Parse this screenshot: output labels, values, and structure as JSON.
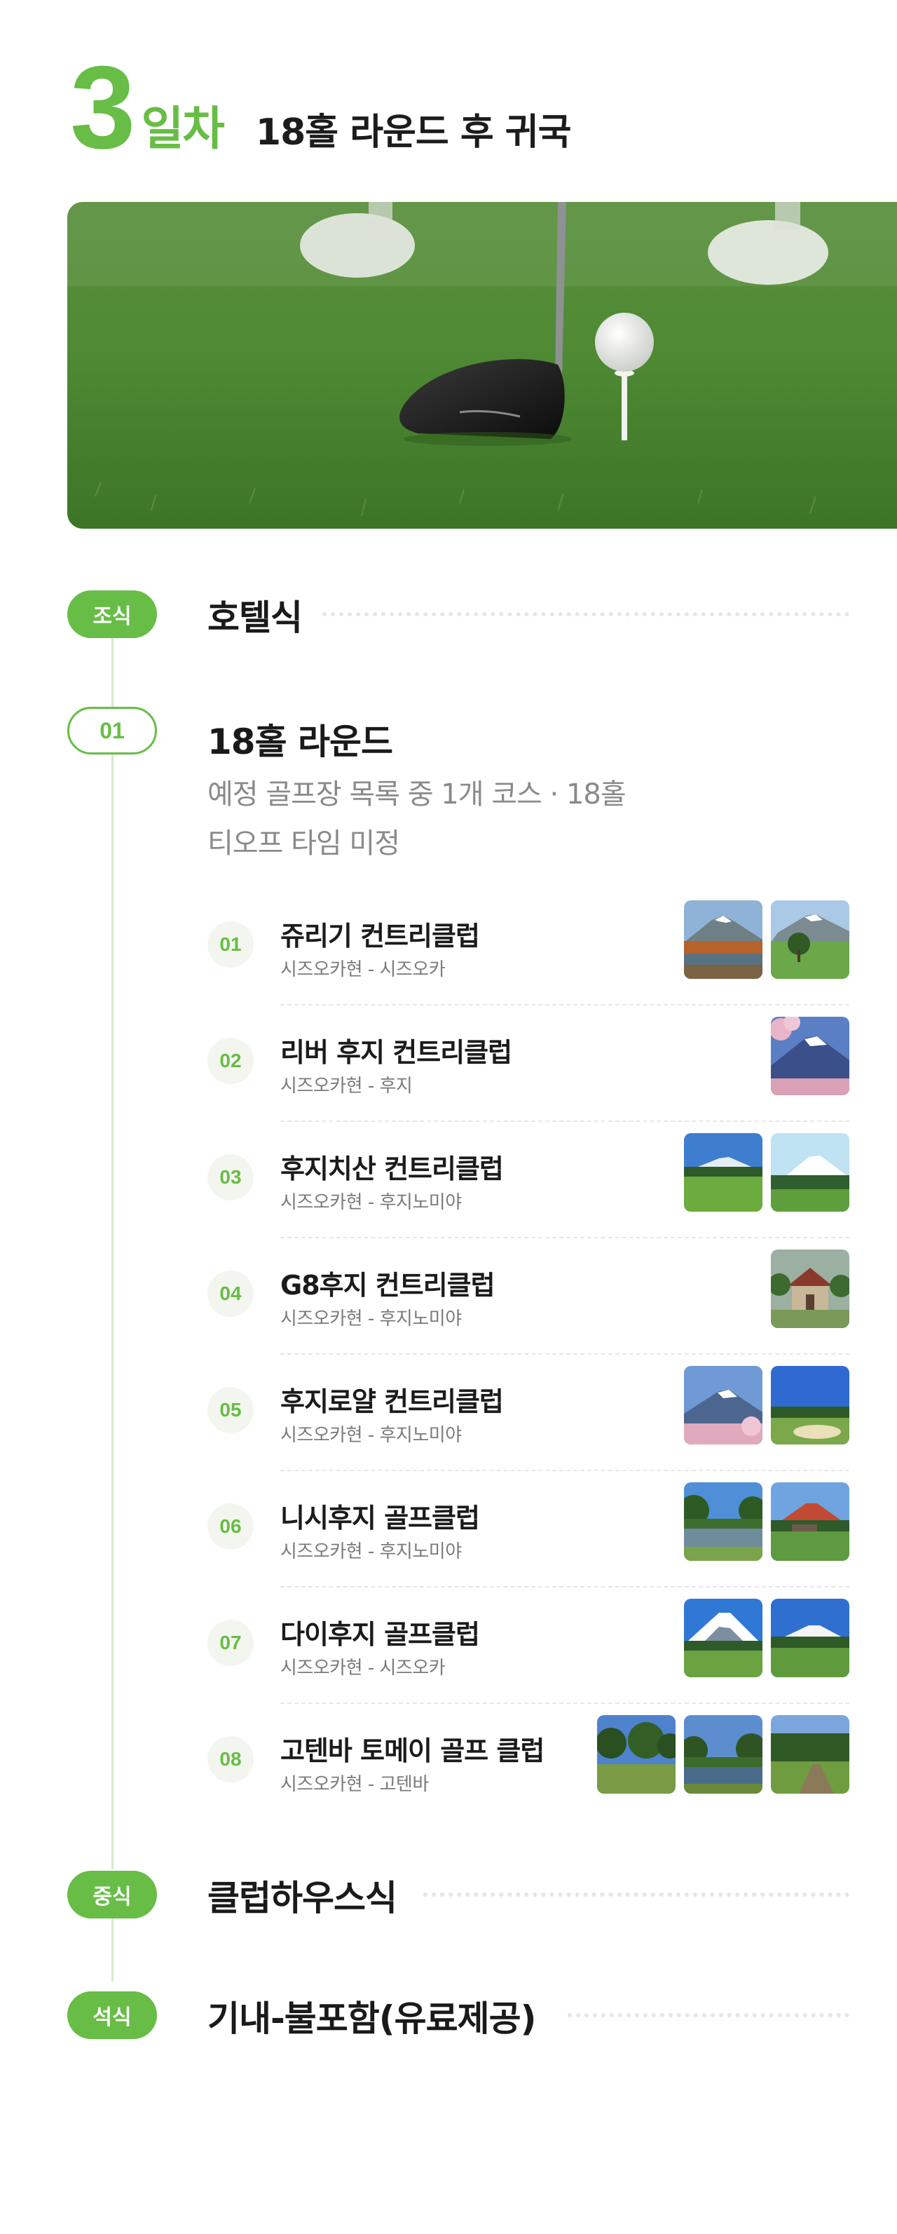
{
  "day": {
    "number": "3",
    "unit": "일차",
    "title": "18홀 라운드 후 귀국"
  },
  "hero": {
    "image": "golf-driver-tee-photo"
  },
  "breakfast": {
    "label": "조식",
    "value": "호텔식"
  },
  "round": {
    "label": "01",
    "title": "18홀 라운드",
    "sub1": "예정 골프장 목록 중 1개 코스 · 18홀",
    "sub2": "티오프 타임 미정"
  },
  "courses": [
    {
      "num": "01",
      "name": "쥬리기 컨트리클럽",
      "loc": "시즈오카현 - 시즈오카",
      "images": [
        "fuji-lake-autumn",
        "fuji-green-tree"
      ]
    },
    {
      "num": "02",
      "name": "리버 후지 컨트리클럽",
      "loc": "시즈오카현 - 후지",
      "images": [
        "fuji-cherry-blossom"
      ]
    },
    {
      "num": "03",
      "name": "후지치산 컨트리클럽",
      "loc": "시즈오카현 - 후지노미야",
      "images": [
        "fuji-fairway",
        "fuji-snow-cap"
      ]
    },
    {
      "num": "04",
      "name": "G8후지 컨트리클럽",
      "loc": "시즈오카현 - 후지노미야",
      "images": [
        "clubhouse-building"
      ]
    },
    {
      "num": "05",
      "name": "후지로얄 컨트리클럽",
      "loc": "시즈오카현 - 후지노미야",
      "images": [
        "fuji-cherry-blossom",
        "bunker-fairway"
      ]
    },
    {
      "num": "06",
      "name": "니시후지 골프클럽",
      "loc": "시즈오카현 - 후지노미야",
      "images": [
        "fuji-pond",
        "fuji-red-sunset"
      ]
    },
    {
      "num": "07",
      "name": "다이후지 골프클럽",
      "loc": "시즈오카현 - 시즈오카",
      "images": [
        "fuji-big-snow",
        "fuji-fairway"
      ]
    },
    {
      "num": "08",
      "name": "고텐바 토메이 골프 클럽",
      "loc": "시즈오카현 - 고텐바",
      "images": [
        "forest-green",
        "forest-pond",
        "forest-path"
      ]
    }
  ],
  "lunch": {
    "label": "중식",
    "value": "클럽하우스식"
  },
  "dinner": {
    "label": "석식",
    "value": "기내-불포함(유료제공)"
  },
  "colors": {
    "accent": "#67bd45",
    "line": "#d6ebcf",
    "text": "#1a1a1a",
    "muted": "#8a8a8a"
  }
}
